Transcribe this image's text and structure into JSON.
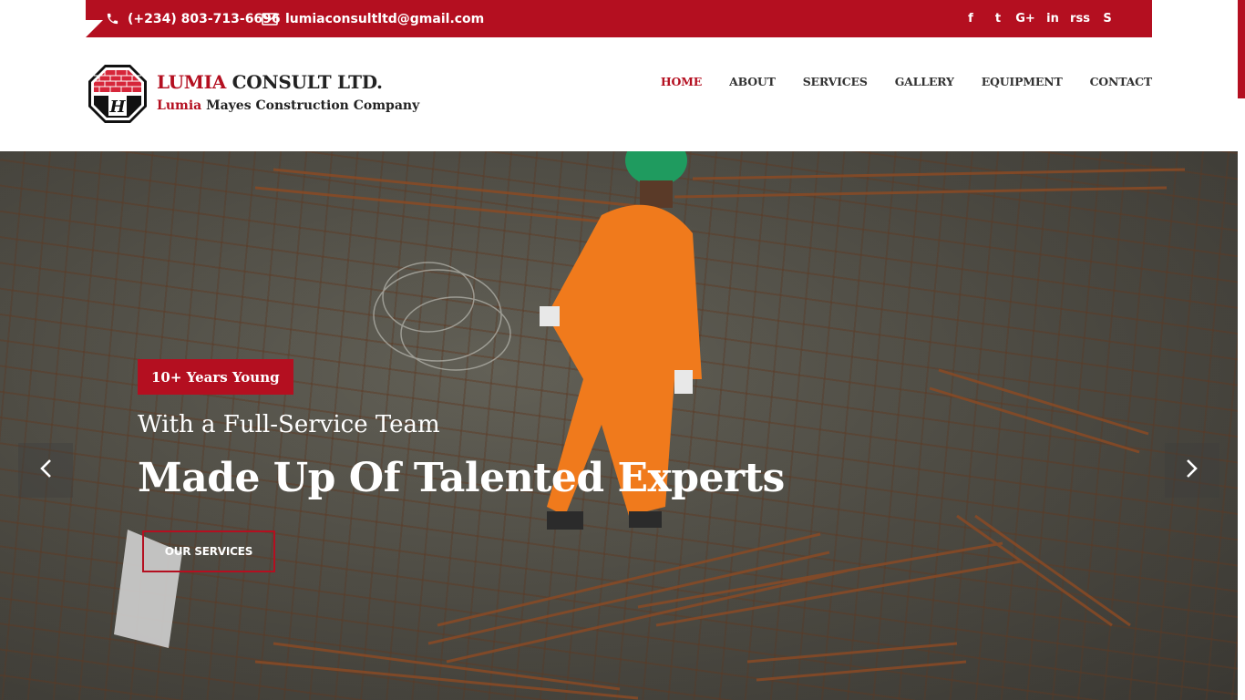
{
  "topbar": {
    "phone": "(+234) 803-713-6696",
    "email": "lumiaconsultltd@gmail.com",
    "social_icons": [
      "facebook-icon",
      "twitter-icon",
      "google-plus-icon",
      "linkedin-icon",
      "rss-icon",
      "skype-icon"
    ],
    "social_glyphs": [
      "f",
      "t",
      "G+",
      "in",
      "rss",
      "S"
    ]
  },
  "brand": {
    "title_accent": "LUMIA",
    "title_rest": " CONSULT LTD.",
    "sub_accent": "Lumia",
    "sub_rest": " Mayes Construction Company",
    "logo_letter": "H"
  },
  "nav": {
    "items": [
      {
        "label": "HOME",
        "active": true
      },
      {
        "label": "ABOUT",
        "active": false
      },
      {
        "label": "SERVICES",
        "active": false
      },
      {
        "label": "GALLERY",
        "active": false
      },
      {
        "label": "EQUIPMENT",
        "active": false
      },
      {
        "label": "CONTACT",
        "active": false
      }
    ]
  },
  "hero": {
    "badge": "10+ Years Young",
    "subtitle": "With a Full-Service Team",
    "title": "Made Up Of Talented Experts",
    "cta": "OUR SERVICES",
    "prev_icon": "chevron-left-icon",
    "next_icon": "chevron-right-icon"
  },
  "colors": {
    "brand_red": "#b40f20",
    "text_dark": "#222222"
  }
}
